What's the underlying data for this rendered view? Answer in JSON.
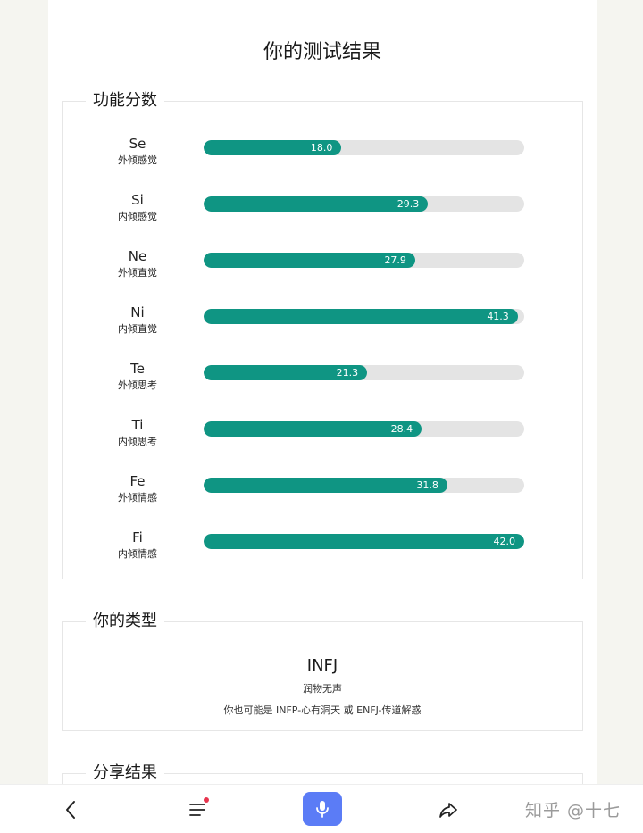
{
  "page": {
    "title": "你的测试结果"
  },
  "functions_panel": {
    "legend": "功能分数",
    "items": [
      {
        "code": "Se",
        "name": "外倾感觉",
        "value": 18.0,
        "label": "18.0",
        "fraction": 0.43
      },
      {
        "code": "Si",
        "name": "内倾感觉",
        "value": 29.3,
        "label": "29.3",
        "fraction": 0.7
      },
      {
        "code": "Ne",
        "name": "外倾直觉",
        "value": 27.9,
        "label": "27.9",
        "fraction": 0.66
      },
      {
        "code": "Ni",
        "name": "内倾直觉",
        "value": 41.3,
        "label": "41.3",
        "fraction": 0.98
      },
      {
        "code": "Te",
        "name": "外倾思考",
        "value": 21.3,
        "label": "21.3",
        "fraction": 0.51
      },
      {
        "code": "Ti",
        "name": "内倾思考",
        "value": 28.4,
        "label": "28.4",
        "fraction": 0.68
      },
      {
        "code": "Fe",
        "name": "外倾情感",
        "value": 31.8,
        "label": "31.8",
        "fraction": 0.76
      },
      {
        "code": "Fi",
        "name": "内倾情感",
        "value": 42.0,
        "label": "42.0",
        "fraction": 1.0
      }
    ]
  },
  "type_panel": {
    "legend": "你的类型",
    "type": "INFJ",
    "nickname": "润物无声",
    "alternatives": "你也可能是 INFP-心有洞天 或 ENFJ-传道解惑"
  },
  "share_panel": {
    "legend": "分享结果"
  },
  "bottom_bar": {
    "items": [
      "back-icon",
      "menu-icon",
      "microphone-icon",
      "share-icon"
    ]
  },
  "watermark": "知乎 @十七",
  "colors": {
    "accent": "#0f9583",
    "track": "#e4e4e4",
    "mic_button": "#5b7cf6",
    "notification_dot": "#e8344e"
  }
}
